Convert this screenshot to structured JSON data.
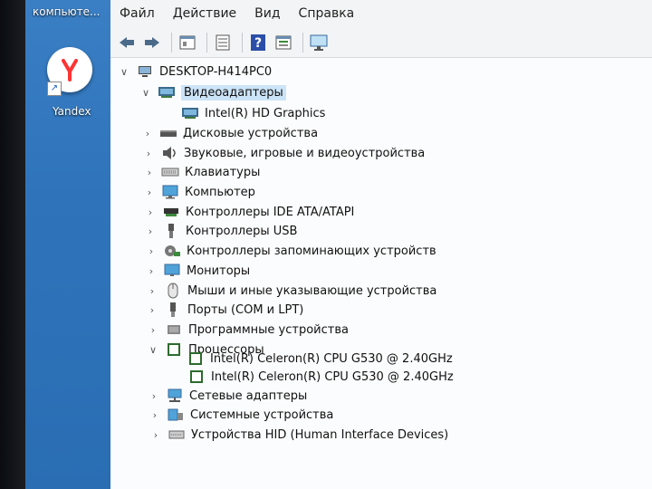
{
  "desktop": {
    "top_label": "компьюте...",
    "yandex_label": "Yandex"
  },
  "menu": {
    "file": "Файл",
    "action": "Действие",
    "view": "Вид",
    "help": "Справка"
  },
  "toolbar": {
    "icons": [
      "back-icon",
      "forward-icon",
      "properties-icon",
      "list-icon",
      "help-icon",
      "device-view-icon",
      "monitor-scan-icon"
    ]
  },
  "tree": {
    "root": "DESKTOP-H414PC0",
    "categories": [
      {
        "label": "Видеоадаптеры",
        "expanded": true,
        "selected": true,
        "children": [
          "Intel(R) HD Graphics"
        ]
      },
      {
        "label": "Дисковые устройства"
      },
      {
        "label": "Звуковые, игровые и видеоустройства"
      },
      {
        "label": "Клавиатуры"
      },
      {
        "label": "Компьютер"
      },
      {
        "label": "Контроллеры IDE ATA/ATAPI"
      },
      {
        "label": "Контроллеры USB"
      },
      {
        "label": "Контроллеры запоминающих устройств"
      },
      {
        "label": "Мониторы"
      },
      {
        "label": "Мыши и иные указывающие устройства"
      },
      {
        "label": "Порты (COM и LPT)"
      },
      {
        "label": "Программные устройства"
      },
      {
        "label": "Процессоры",
        "expanded": true,
        "children": [
          "Intel(R) Celeron(R) CPU G530 @ 2.40GHz",
          "Intel(R) Celeron(R) CPU G530 @ 2.40GHz"
        ]
      },
      {
        "label": "Сетевые адаптеры"
      },
      {
        "label": "Системные устройства"
      },
      {
        "label": "Устройства HID (Human Interface Devices)"
      }
    ]
  },
  "colors": {
    "selection": "#cce4f7",
    "desktop_blue": "#2f74bb",
    "window_bg": "#fbfcfd"
  }
}
